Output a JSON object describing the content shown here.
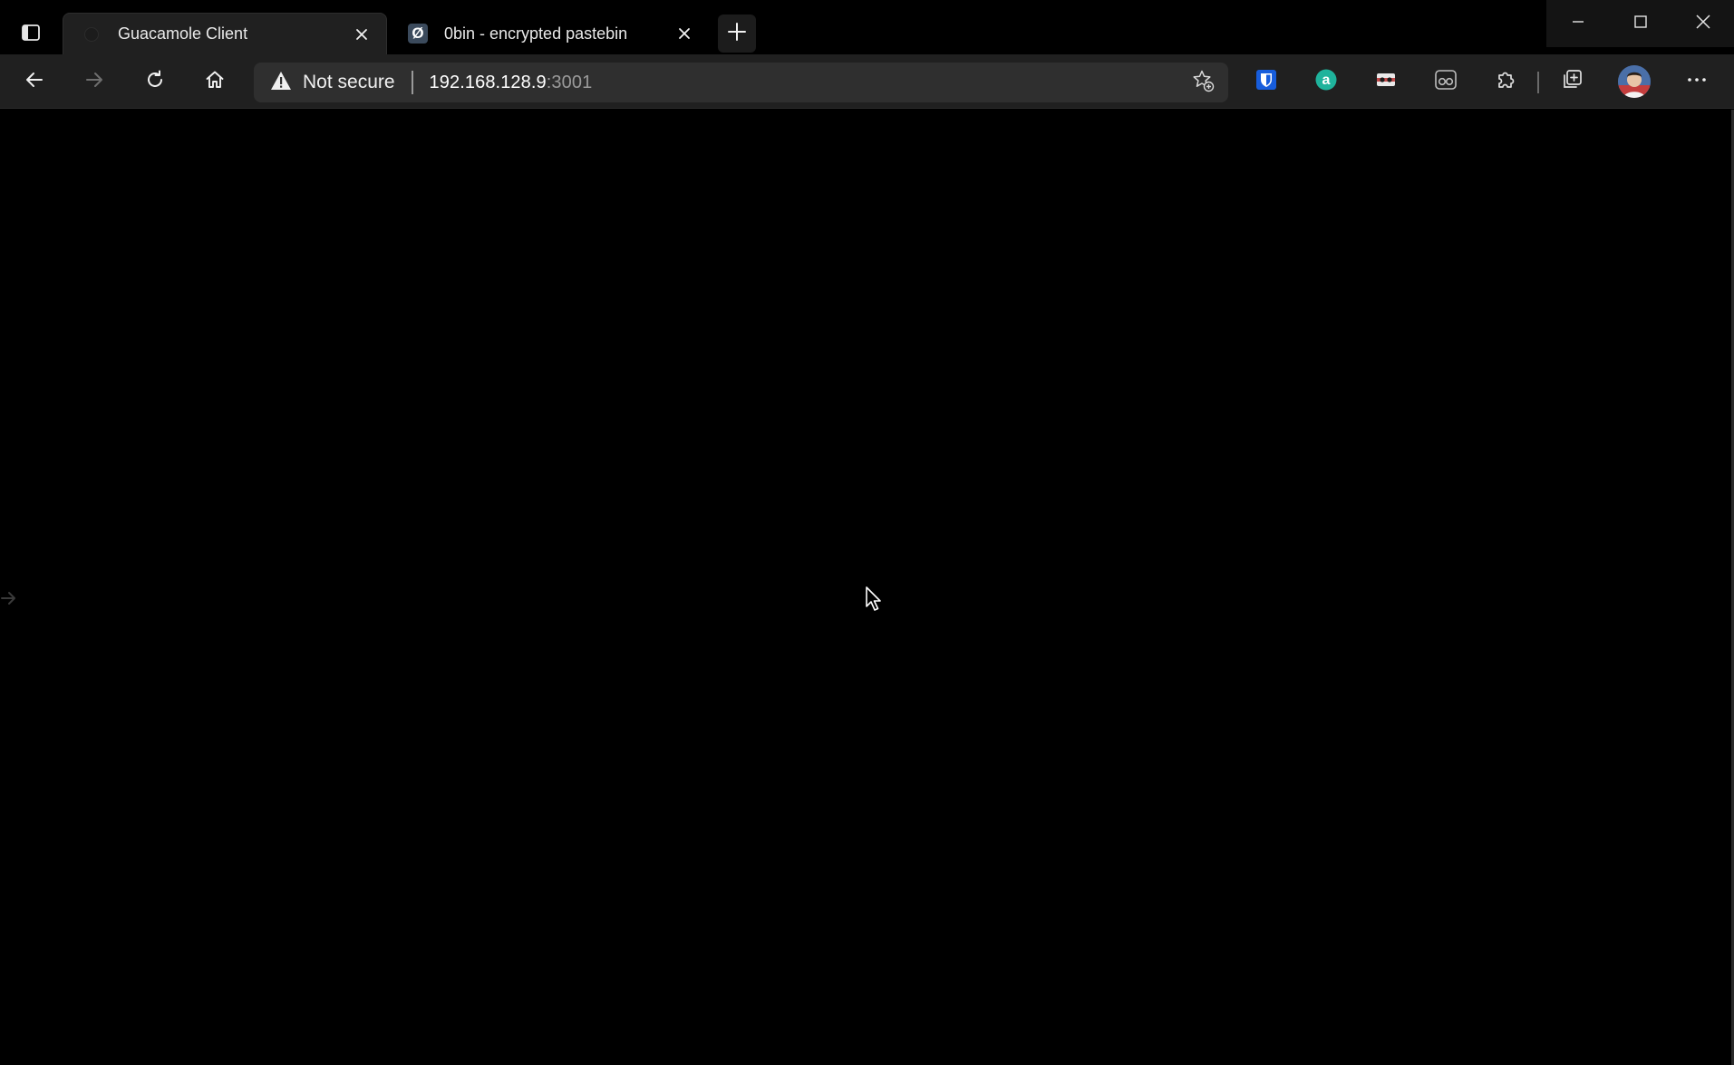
{
  "browser": {
    "tabs": [
      {
        "title": "Guacamole Client",
        "active": true,
        "favicon": "guacamole-favicon-icon"
      },
      {
        "title": "0bin - encrypted pastebin",
        "active": false,
        "favicon": "0bin-favicon-icon",
        "favicon_glyph": "Ø"
      }
    ],
    "new_tab_icon": "plus-icon",
    "window_controls": [
      "minimize-icon",
      "maximize-icon",
      "close-icon"
    ]
  },
  "toolbar": {
    "back_icon": "back-arrow-icon",
    "forward_icon": "forward-arrow-icon",
    "refresh_icon": "refresh-icon",
    "home_icon": "home-icon",
    "security_label": "Not secure",
    "url_host": "192.168.128.9",
    "url_port": ":3001",
    "favorites_icon": "add-favorite-icon",
    "extensions": [
      {
        "name": "bitwarden-icon",
        "color": "#175ddc"
      },
      {
        "name": "a-extension-icon",
        "color": "#1fb39c"
      },
      {
        "name": "privacy-extension-icon",
        "color": "#c24a4a"
      },
      {
        "name": "reader-glasses-icon",
        "color": "#bdbdbd"
      },
      {
        "name": "extensions-puzzle-icon",
        "color": "#e0e0e0"
      }
    ],
    "collections_icon": "collections-icon",
    "profile_icon": "profile-avatar",
    "menu_icon": "more-menu-icon"
  },
  "content": {
    "background": "#000000",
    "edge_arrow_icon": "guacamole-menu-arrow-icon"
  },
  "colors": {
    "tab_active_bg": "#202020",
    "toolbar_bg": "#202020",
    "address_bg": "#2f2f2f",
    "text_primary": "#ffffff",
    "text_muted": "#9a9a9a"
  }
}
